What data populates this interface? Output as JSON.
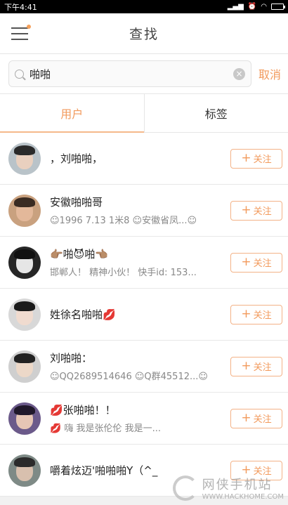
{
  "status_bar": {
    "time": "下午4:41"
  },
  "header": {
    "title": "查找"
  },
  "search": {
    "value": "啪啪",
    "cancel_label": "取消"
  },
  "tabs": [
    {
      "label": "用户",
      "active": true
    },
    {
      "label": "标签",
      "active": false
    }
  ],
  "follow_label": "关注",
  "users": [
    {
      "name": "，刘啪啪，",
      "sub": "",
      "avatar_bg": "#b9c3c9",
      "hair": "#2a2a2a",
      "face": "#e9d0bf"
    },
    {
      "name": "安徽啪啪哥",
      "sub": "☺1996 7.13  1米8  ☺安徽省凤...☺",
      "avatar_bg": "#c9a17f",
      "hair": "#3a2b22",
      "face": "#e3b89a"
    },
    {
      "name": "👉🏽啪😈啪👈🏽",
      "sub": "邯郸人！ 精神小伙！ 快手id: 153...",
      "avatar_bg": "#262626",
      "hair": "#111111",
      "face": "#e6e6e6"
    },
    {
      "name": "姓徐名啪啪💋",
      "sub": "",
      "avatar_bg": "#d8d8d8",
      "hair": "#1b1b1b",
      "face": "#f0dbcf"
    },
    {
      "name": "刘啪啪：",
      "sub": "☺QQ2689514646  ☺Q群45512...☺",
      "avatar_bg": "#cfcfcf",
      "hair": "#222222",
      "face": "#ecd8c8"
    },
    {
      "name": "💋张啪啪！！",
      "sub": "💋 嗨 我是张伦伦          我是一...",
      "avatar_bg": "#6b5a8a",
      "hair": "#20182a",
      "face": "#e6c6b5"
    },
    {
      "name": "嚼着炫迈'啪啪啪Y（^_",
      "sub": "",
      "avatar_bg": "#7e8a86",
      "hair": "#2b2b2b",
      "face": "#d8c0ae"
    }
  ],
  "watermark": {
    "cn": "网侠手机站",
    "en": "WWW.HACKHOME.COM"
  }
}
